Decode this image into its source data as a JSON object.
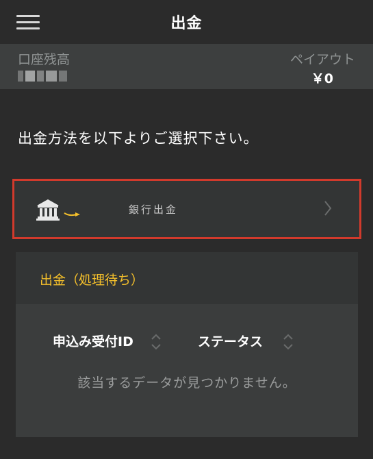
{
  "header": {
    "title": "出金"
  },
  "balance": {
    "label": "口座残高",
    "payout_label": "ペイアウト",
    "payout_value": "￥0"
  },
  "instruction": "出金方法を以下よりご選択下さい。",
  "methods": [
    {
      "label": "銀行出金"
    }
  ],
  "pending": {
    "title": "出金（処理待ち）",
    "columns": [
      "申込み受付ID",
      "ステータス"
    ],
    "empty_message": "該当するデータが見つかりません。"
  },
  "colors": {
    "background": "#2b2b2b",
    "balance_bar": "#3d3f3f",
    "accent_yellow": "#f5c02b",
    "highlight_red": "#d23a2c"
  }
}
